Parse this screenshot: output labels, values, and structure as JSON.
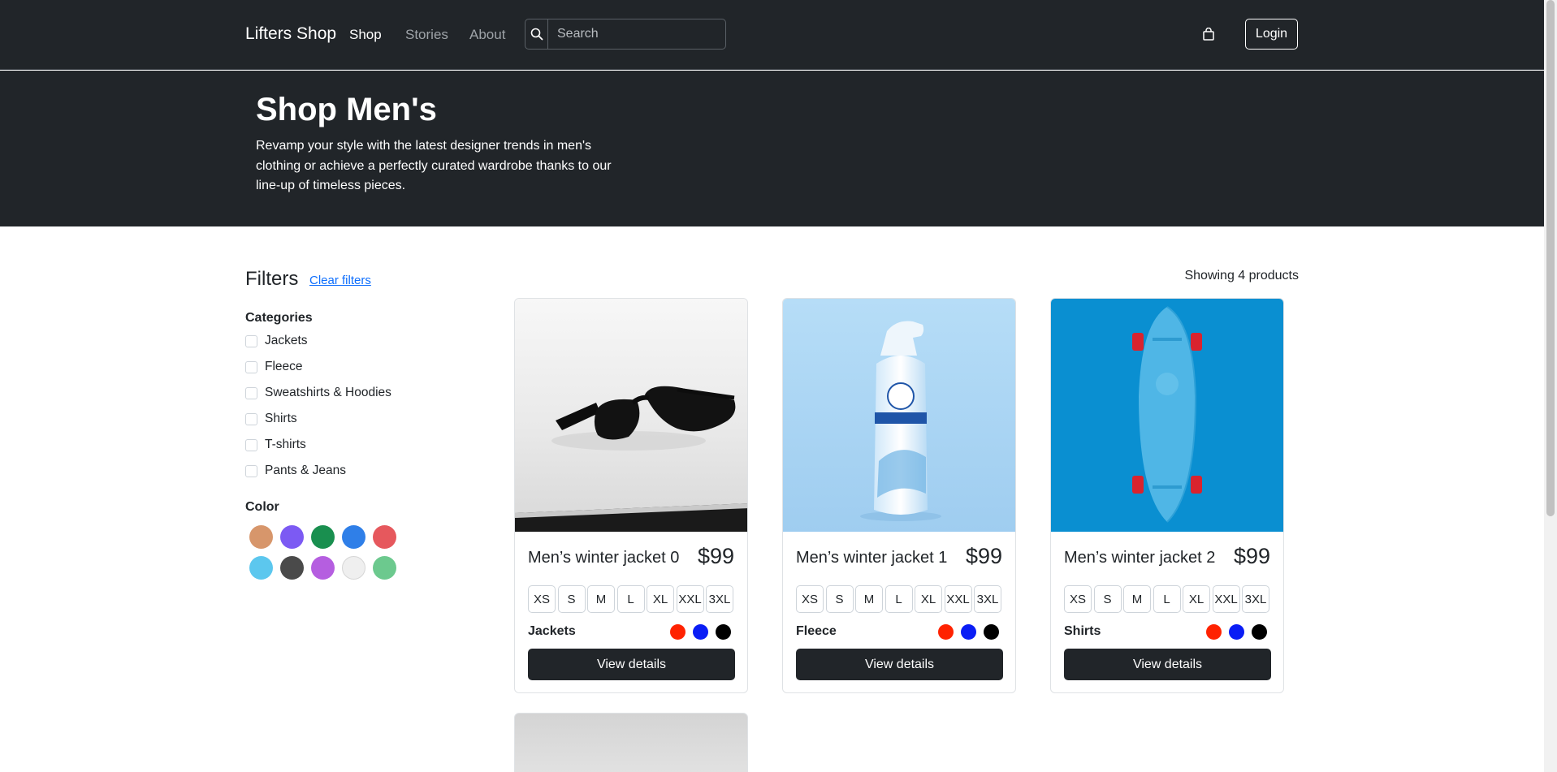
{
  "nav": {
    "brand": "Lifters Shop",
    "links": [
      {
        "label": "Shop",
        "active": true
      },
      {
        "label": "Stories"
      },
      {
        "label": "About"
      }
    ],
    "search_placeholder": "Search",
    "login_label": "Login"
  },
  "hero": {
    "title": "Shop Men's",
    "subtitle": "Revamp your style with the latest designer trends in men's clothing or achieve a perfectly curated wardrobe thanks to our line-up of timeless pieces."
  },
  "filters": {
    "title": "Filters",
    "clear_label": "Clear filters",
    "categories_label": "Categories",
    "categories": [
      "Jackets",
      "Fleece",
      "Sweatshirts & Hoodies",
      "Shirts",
      "T-shirts",
      "Pants & Jeans"
    ],
    "color_label": "Color",
    "colors": [
      "#d7966b",
      "#7c5af3",
      "#198f4f",
      "#2f7fe8",
      "#e6585d",
      "#5cc7ee",
      "#4a4a4a",
      "#b55ee0",
      "#efefef",
      "#6cc98e"
    ]
  },
  "results": {
    "showing": "Showing 4 products"
  },
  "products": [
    {
      "name": "Men’s winter jacket 0",
      "price": "$99",
      "sizes": [
        "XS",
        "S",
        "M",
        "L",
        "XL",
        "XXL",
        "3XL"
      ],
      "category": "Jackets",
      "colors": [
        "#ff2200",
        "#0a1df5",
        "#000000"
      ],
      "button": "View details",
      "image": "sunglasses"
    },
    {
      "name": "Men’s winter jacket 1",
      "price": "$99",
      "sizes": [
        "XS",
        "S",
        "M",
        "L",
        "XL",
        "XXL",
        "3XL"
      ],
      "category": "Fleece",
      "colors": [
        "#ff2200",
        "#0a1df5",
        "#000000"
      ],
      "button": "View details",
      "image": "air-freshener"
    },
    {
      "name": "Men’s winter jacket 2",
      "price": "$99",
      "sizes": [
        "XS",
        "S",
        "M",
        "L",
        "XL",
        "XXL",
        "3XL"
      ],
      "category": "Shirts",
      "colors": [
        "#ff2200",
        "#0a1df5",
        "#000000"
      ],
      "button": "View details",
      "image": "skateboard"
    }
  ]
}
